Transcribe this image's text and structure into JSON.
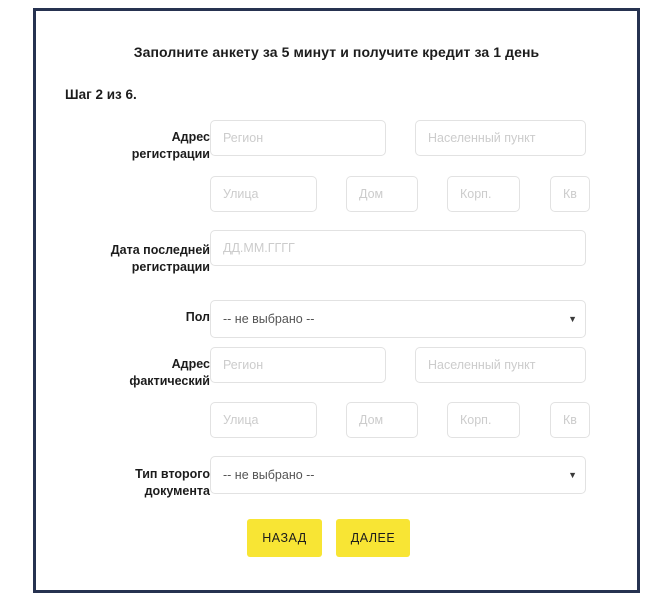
{
  "form": {
    "title": "Заполните анкету за 5 минут и получите кредит за 1 день",
    "step": "Шаг 2 из 6."
  },
  "colors": {
    "frame_border": "#263250",
    "button_yellow": "#f8e534",
    "input_border": "#e2e2e2",
    "placeholder": "#cccccc",
    "text": "#1c1c1c"
  },
  "fields": {
    "reg_address": {
      "label_line1": "Адрес",
      "label_line2": "регистрации",
      "region_placeholder": "Регион",
      "locality_placeholder": "Населенный пункт",
      "street_placeholder": "Улица",
      "house_placeholder": "Дом",
      "building_placeholder": "Корп.",
      "apartment_placeholder": "Кв."
    },
    "last_reg_date": {
      "label_line1": "Дата последней",
      "label_line2": "регистрации",
      "placeholder": "ДД.ММ.ГГГГ"
    },
    "gender": {
      "label": "Пол",
      "value": "-- не выбрано --",
      "arrow_icon": "chevron-down-icon"
    },
    "actual_address": {
      "label_line1": "Адрес",
      "label_line2": "фактический",
      "region_placeholder": "Регион",
      "locality_placeholder": "Населенный пункт",
      "street_placeholder": "Улица",
      "house_placeholder": "Дом",
      "building_placeholder": "Корп.",
      "apartment_placeholder": "Кв."
    },
    "second_document_type": {
      "label_line1": "Тип второго",
      "label_line2": "документа",
      "value": "-- не выбрано --",
      "arrow_icon": "chevron-down-icon"
    }
  },
  "buttons": {
    "back": "НАЗАД",
    "next": "ДАЛЕЕ"
  }
}
